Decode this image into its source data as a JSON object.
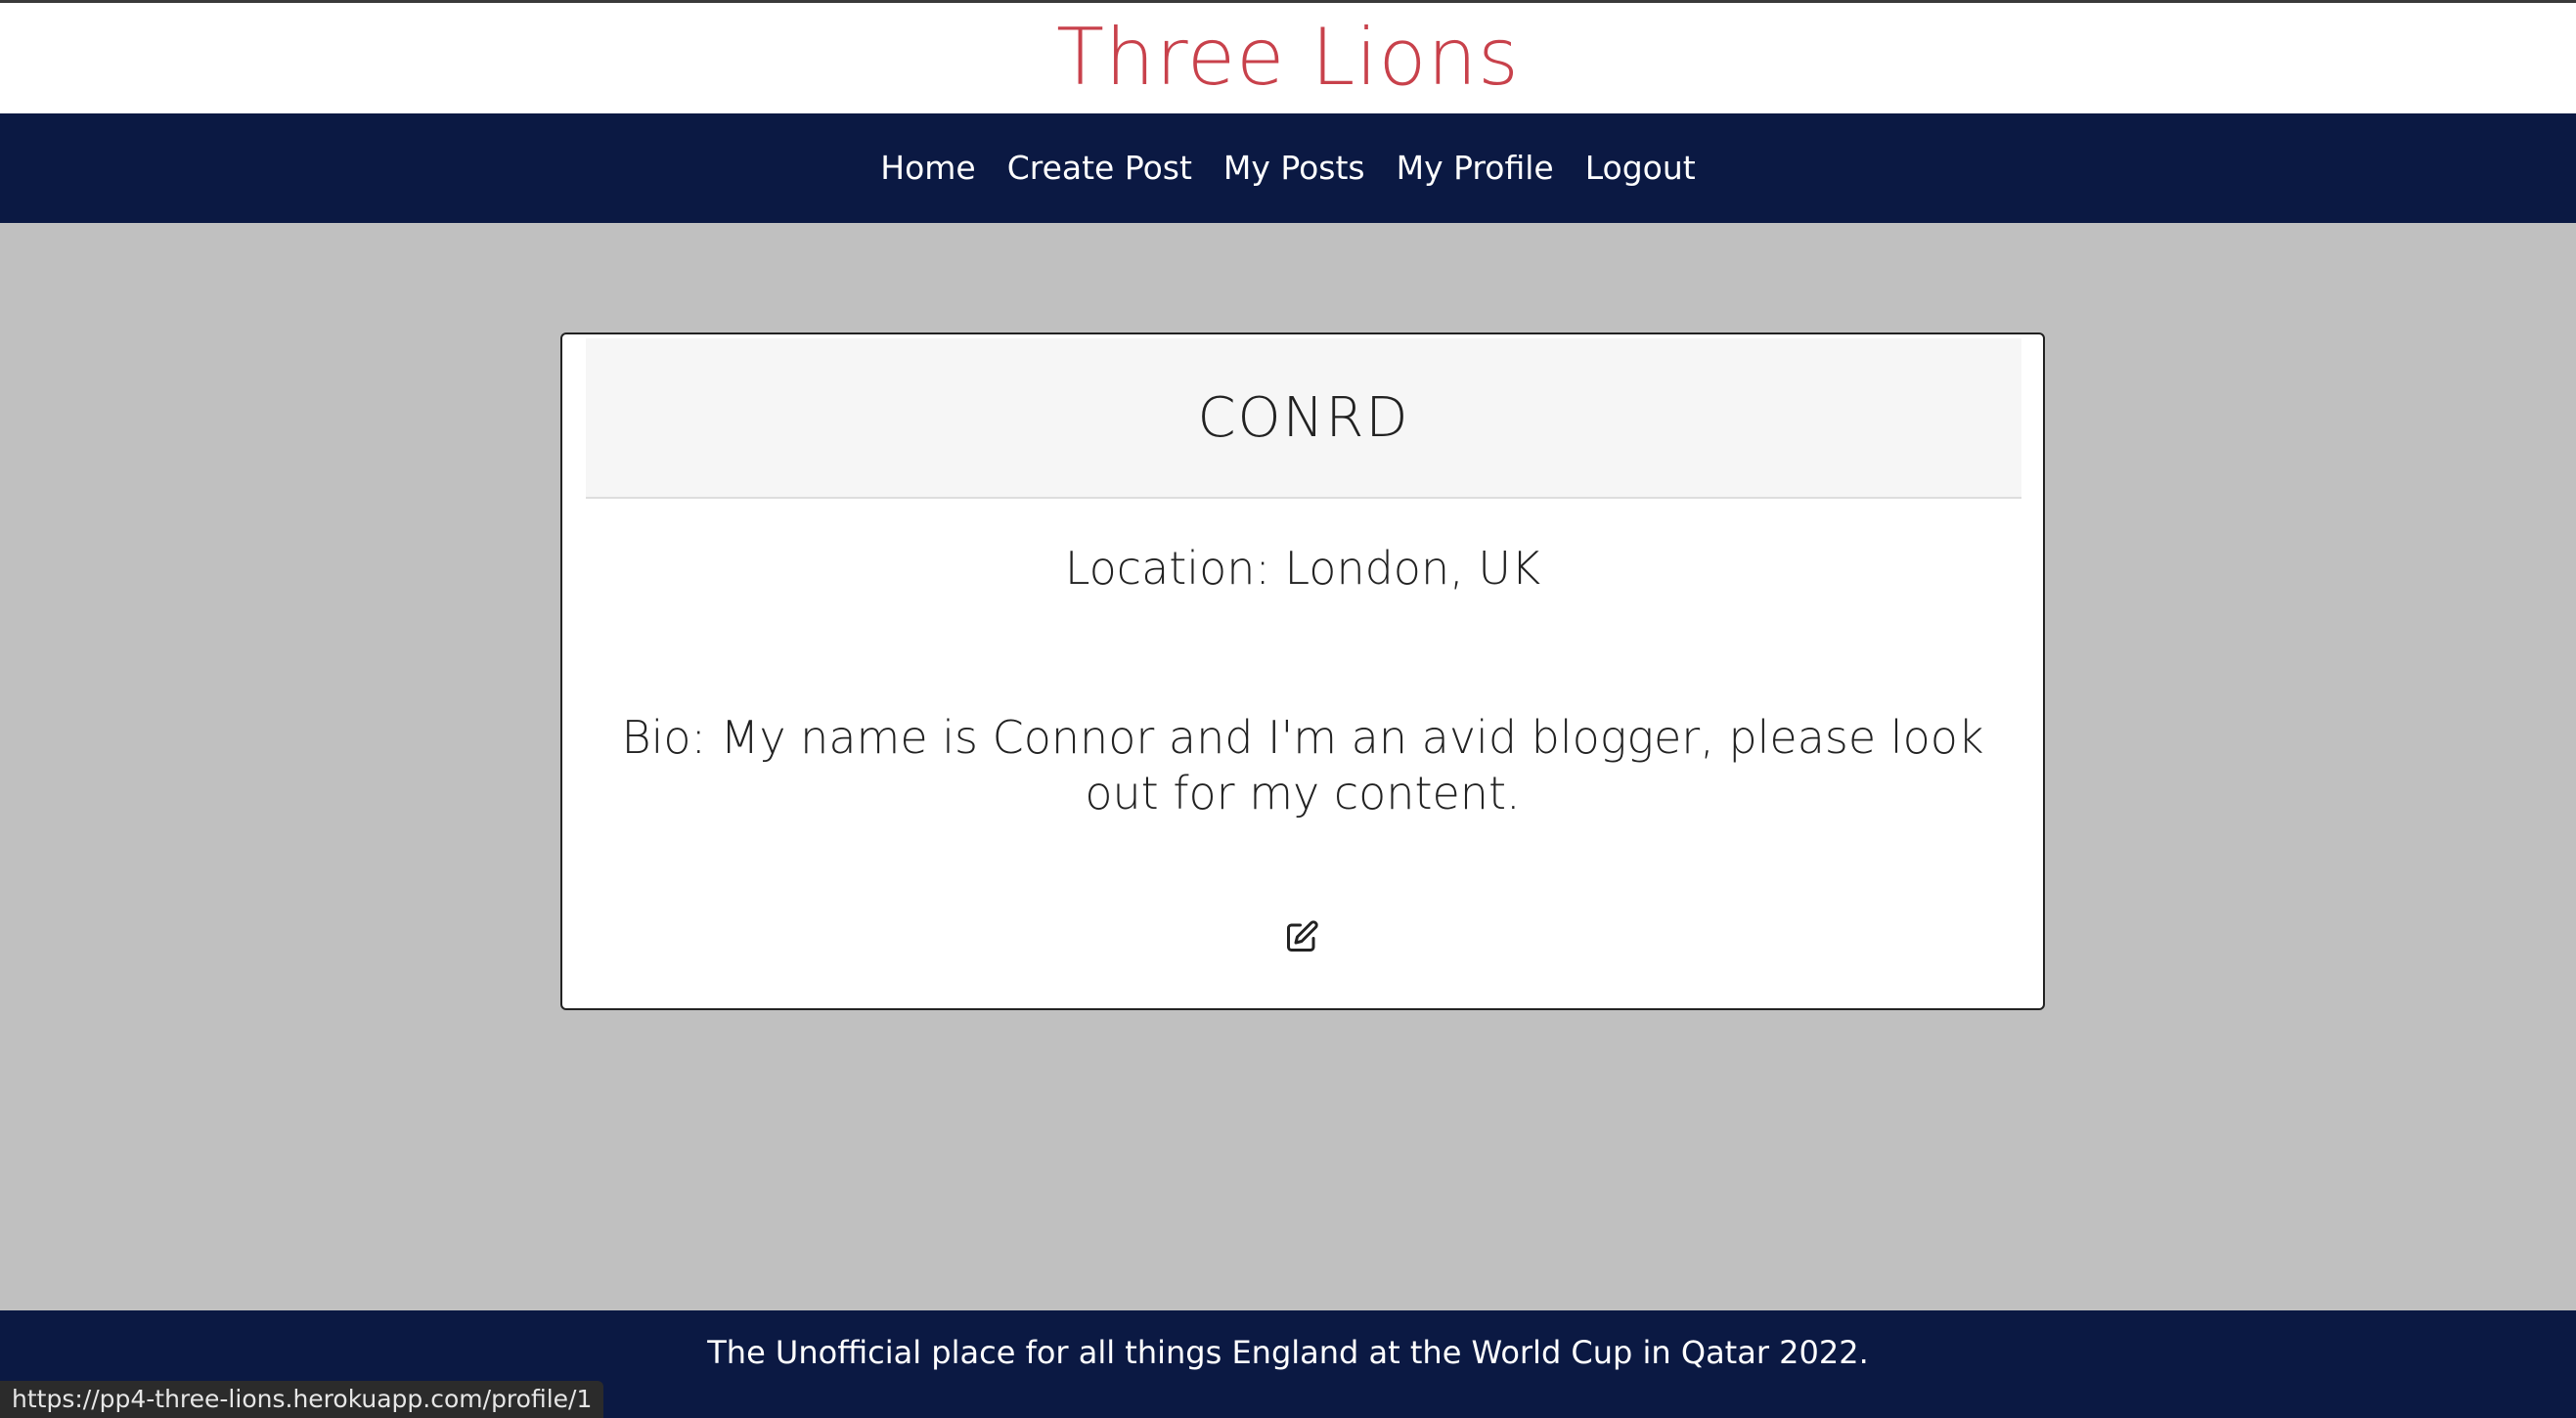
{
  "site": {
    "title": "Three Lions"
  },
  "nav": {
    "items": [
      {
        "label": "Home"
      },
      {
        "label": "Create Post"
      },
      {
        "label": "My Posts"
      },
      {
        "label": "My Profile"
      },
      {
        "label": "Logout"
      }
    ]
  },
  "profile": {
    "username": "CONRD",
    "location": "Location: London, UK",
    "bio": "Bio: My name is Connor and I'm an avid blogger, please look out for my content.",
    "edit_icon": "edit-icon"
  },
  "footer": {
    "text": "The Unofficial place for all things England at the World Cup in Qatar 2022."
  },
  "status_bar": {
    "url": "https://pp4-three-lions.herokuapp.com/profile/1"
  },
  "colors": {
    "brand_red": "#c8414b",
    "navy": "#0b1943",
    "page_bg": "#c0c0c0"
  }
}
